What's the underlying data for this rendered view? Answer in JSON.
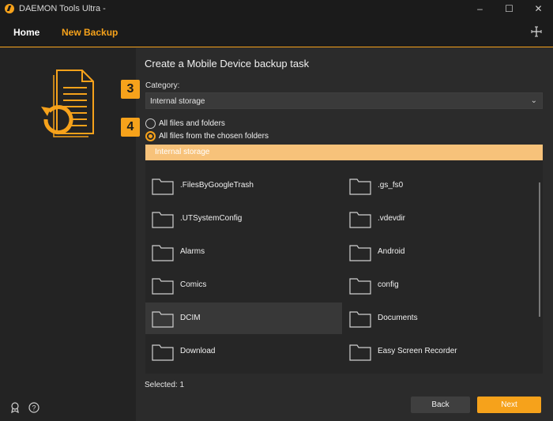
{
  "window": {
    "title": "DAEMON Tools Ultra -",
    "controls": [
      "–",
      "☐",
      "✕"
    ]
  },
  "nav": {
    "home": "Home",
    "new_backup": "New Backup"
  },
  "main": {
    "heading": "Create a Mobile Device backup task",
    "step3": "3",
    "step4": "4",
    "category_label": "Category:",
    "category_value": "Internal storage",
    "radio_all": "All files and folders",
    "radio_chosen": "All files from the chosen folders",
    "tree_header": "Internal storage",
    "folders": [
      ".FilesByGoogleTrash",
      ".gs_fs0",
      ".UTSystemConfig",
      ".vdevdir",
      "Alarms",
      "Android",
      "Comics",
      "config",
      "DCIM",
      "Documents",
      "Download",
      "Easy Screen Recorder"
    ],
    "selected_text": "Selected: 1",
    "back": "Back",
    "next": "Next"
  },
  "colors": {
    "accent": "#f6a21b",
    "header_bg": "#f7c27a",
    "background": "#2b2b2b"
  },
  "icons": {
    "logo": "daemon-tools-logo",
    "plus": "plus-icon",
    "hero": "backup-document-icon",
    "folder": "folder-icon",
    "badge": "badge-icon",
    "help": "help-icon",
    "chevron": "chevron-down-icon"
  }
}
